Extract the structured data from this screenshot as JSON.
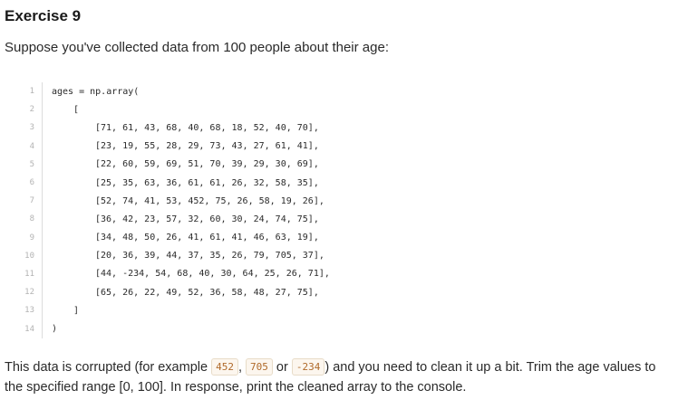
{
  "title": "Exercise 9",
  "intro": "Suppose you've collected data from 100 people about their age:",
  "code": {
    "lines": [
      {
        "num": "1",
        "text": "ages = np.array(",
        "indent": 1
      },
      {
        "num": "2",
        "text": "[",
        "indent": 2
      },
      {
        "num": "3",
        "text": "[71, 61, 43, 68, 40, 68, 18, 52, 40, 70],",
        "indent": 3
      },
      {
        "num": "4",
        "text": "[23, 19, 55, 28, 29, 73, 43, 27, 61, 41],",
        "indent": 3
      },
      {
        "num": "5",
        "text": "[22, 60, 59, 69, 51, 70, 39, 29, 30, 69],",
        "indent": 3
      },
      {
        "num": "6",
        "text": "[25, 35, 63, 36, 61, 61, 26, 32, 58, 35],",
        "indent": 3
      },
      {
        "num": "7",
        "text": "[52, 74, 41, 53, 452, 75, 26, 58, 19, 26],",
        "indent": 3
      },
      {
        "num": "8",
        "text": "[36, 42, 23, 57, 32, 60, 30, 24, 74, 75],",
        "indent": 3
      },
      {
        "num": "9",
        "text": "[34, 48, 50, 26, 41, 61, 41, 46, 63, 19],",
        "indent": 3
      },
      {
        "num": "10",
        "text": "[20, 36, 39, 44, 37, 35, 26, 79, 705, 37],",
        "indent": 3
      },
      {
        "num": "11",
        "text": "[44, -234, 54, 68, 40, 30, 64, 25, 26, 71],",
        "indent": 3
      },
      {
        "num": "12",
        "text": "[65, 26, 22, 49, 52, 36, 58, 48, 27, 75],",
        "indent": 3
      },
      {
        "num": "13",
        "text": "]",
        "indent": 2
      },
      {
        "num": "14",
        "text": ")",
        "indent": 1
      }
    ]
  },
  "outro": {
    "text_before": "This data is corrupted (for example ",
    "ex1": "452",
    "sep1": ", ",
    "ex2": "705",
    "sep2": " or ",
    "ex3": "-234",
    "text_after": ") and you need to clean it up a bit. Trim the age values to the specified range [0, 100]. In response, print the cleaned array to the console."
  }
}
